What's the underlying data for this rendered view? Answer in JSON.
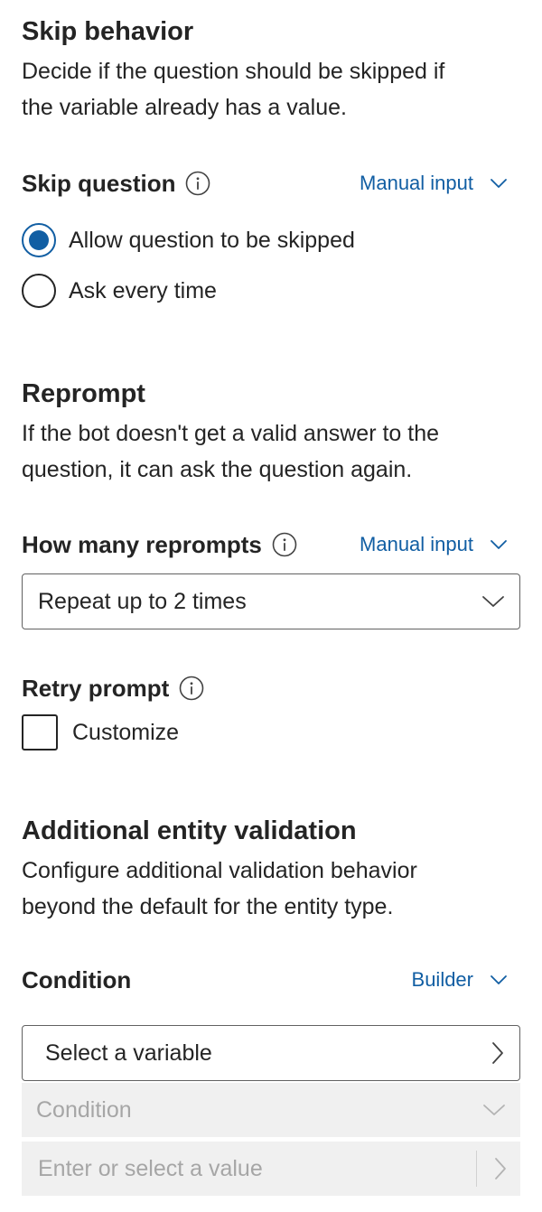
{
  "skip_behavior": {
    "title": "Skip behavior",
    "description_line1": "Decide if the question should be skipped if",
    "description_line2": "the variable already has a value.",
    "field_label": "Skip question",
    "mode": "Manual input",
    "options": [
      {
        "label": "Allow question to be skipped",
        "selected": true
      },
      {
        "label": "Ask every time",
        "selected": false
      }
    ]
  },
  "reprompt": {
    "title": "Reprompt",
    "description_line1": "If the bot doesn't get a valid answer to the",
    "description_line2": "question, it can ask the question again.",
    "field_label": "How many reprompts",
    "mode": "Manual input",
    "selected_value": "Repeat up to 2 times",
    "retry_label": "Retry prompt",
    "customize_label": "Customize",
    "customize_checked": false
  },
  "validation": {
    "title": "Additional entity validation",
    "description_line1": "Configure additional validation behavior",
    "description_line2": "beyond the default for the entity type.",
    "condition_label": "Condition",
    "mode": "Builder",
    "variable_placeholder": "Select a variable",
    "condition_placeholder": "Condition",
    "value_placeholder": "Enter or select a value"
  },
  "colors": {
    "accent": "#115ea3",
    "text": "#242424",
    "disabled_bg": "#f0f0f0",
    "disabled_text": "#a6a6a6"
  }
}
